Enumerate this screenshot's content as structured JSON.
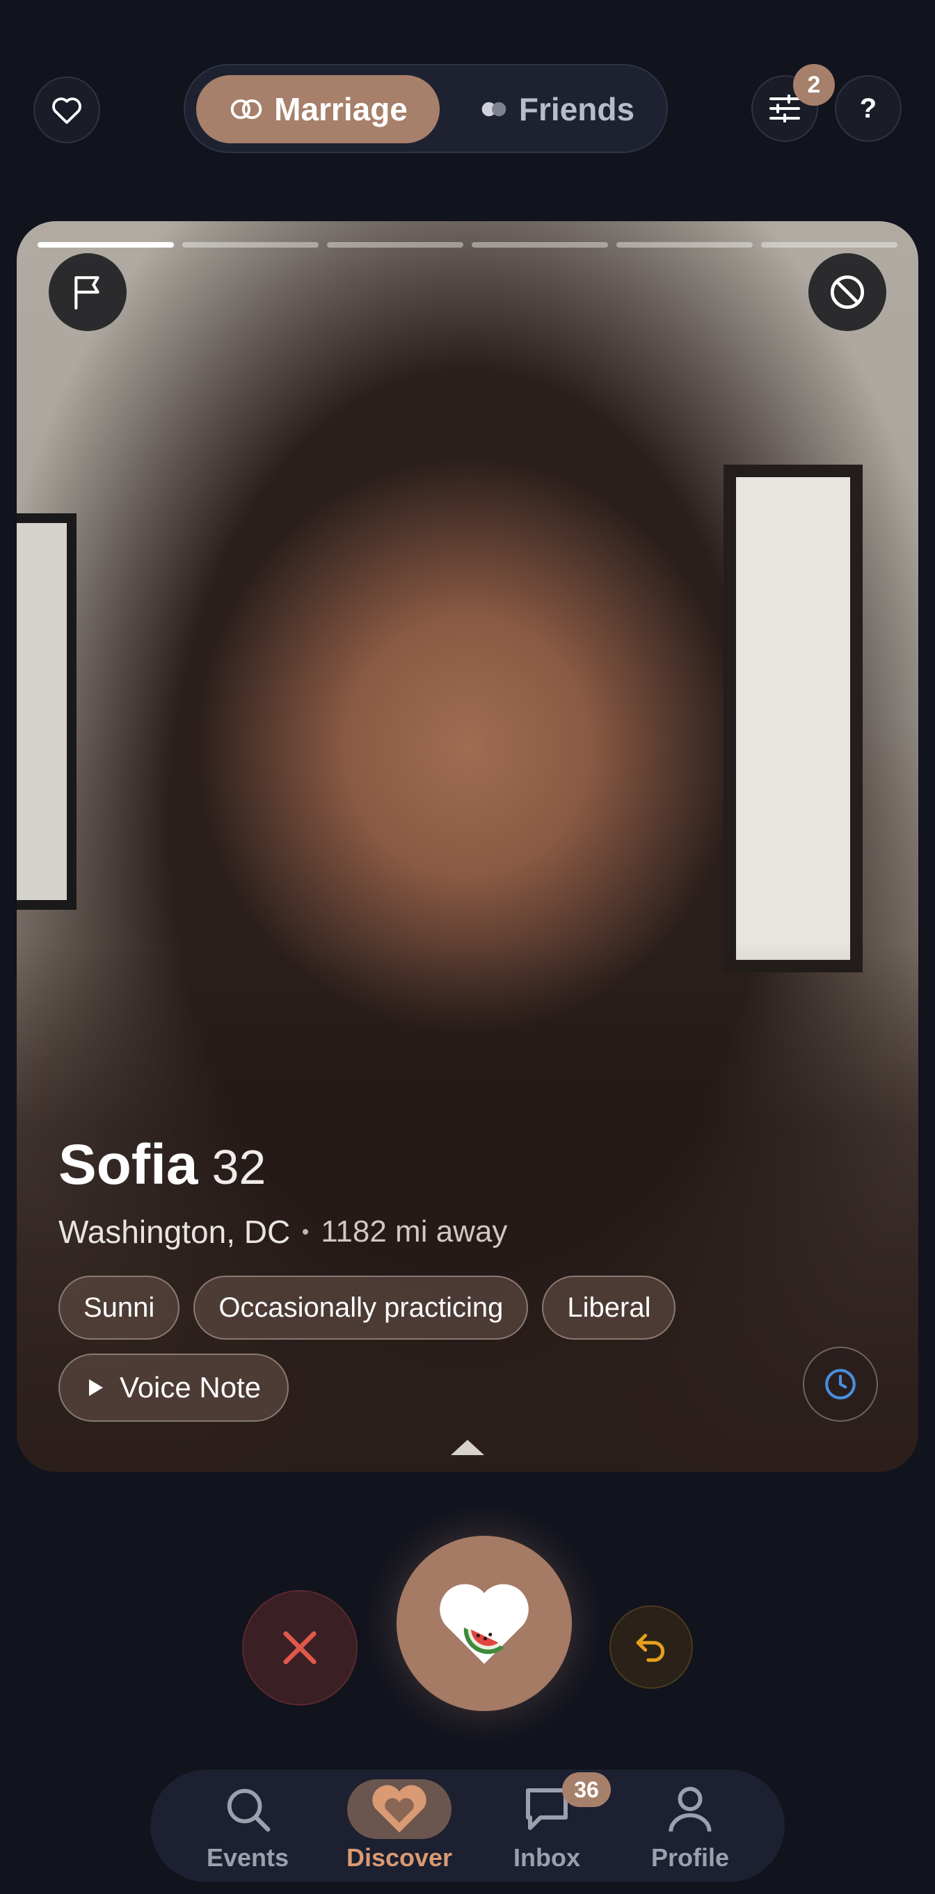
{
  "header": {
    "modes": [
      {
        "label": "Marriage",
        "active": true
      },
      {
        "label": "Friends",
        "active": false
      }
    ],
    "filter_badge": "2",
    "help_label": "?"
  },
  "card": {
    "photo_count": 6,
    "current_photo": 1,
    "name": "Sofia",
    "age": "32",
    "location": "Washington, DC",
    "distance": "1182 mi away",
    "chips": [
      "Sunni",
      "Occasionally practicing",
      "Liberal"
    ],
    "voice_note_label": "Voice Note"
  },
  "nav": {
    "items": [
      {
        "label": "Events",
        "icon": "search-icon",
        "active": false
      },
      {
        "label": "Discover",
        "icon": "heart-icon",
        "active": true
      },
      {
        "label": "Inbox",
        "icon": "chat-icon",
        "active": false,
        "badge": "36"
      },
      {
        "label": "Profile",
        "icon": "person-icon",
        "active": false
      }
    ]
  },
  "colors": {
    "background": "#11131d",
    "accent": "#a7806b",
    "active_nav": "#d99a74",
    "pass": "#e0584a",
    "undo": "#e6a01e",
    "history": "#4a8fe0"
  }
}
